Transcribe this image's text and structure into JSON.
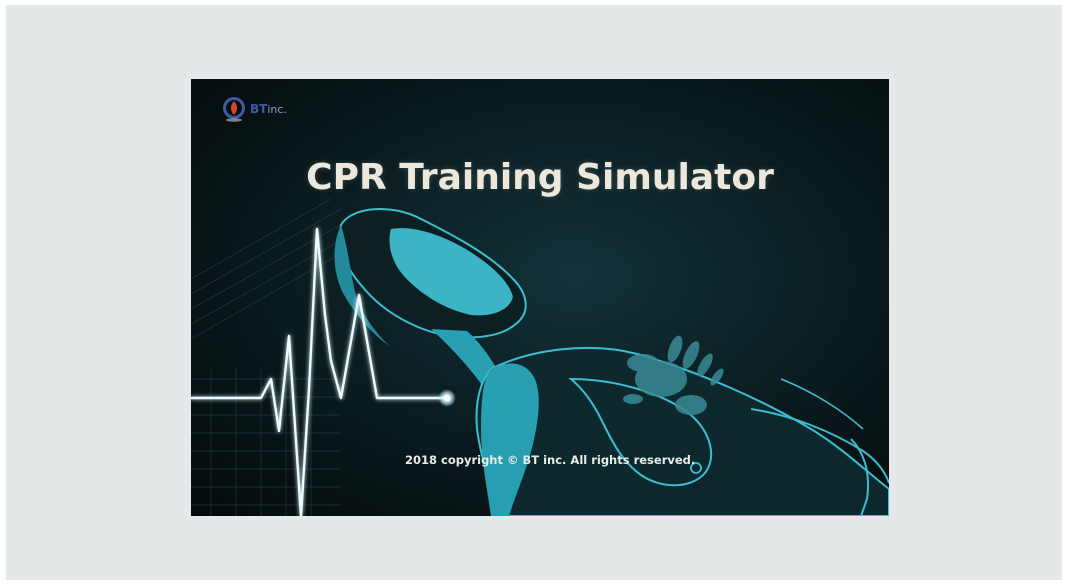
{
  "splash": {
    "logo_text": "BT",
    "logo_sub": "inc.",
    "title": "CPR Training Simulator",
    "copyright": "2018 copyright © BT inc. All rights reserved."
  },
  "colors": {
    "background": "#e5e8e8",
    "splash_bg": "#0b1e22",
    "accent_cyan": "#3fb8cc",
    "title": "#ece8dc",
    "logo_blue": "#3f5aa8",
    "logo_red": "#d9452b"
  },
  "icons": {
    "logo": "bt-inc-logo-icon",
    "ecg": "heartbeat-line-icon",
    "manikin": "cpr-manikin-illustration"
  }
}
